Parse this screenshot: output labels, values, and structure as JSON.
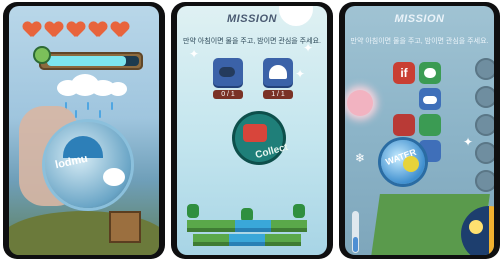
{
  "screens": [
    {
      "hearts_count": 5,
      "water_gauge": {
        "fill_percent": 86
      },
      "orb_label": "lodmu"
    },
    {
      "title": "MISSION",
      "instruction": "만약 아침이면 물을 주고, 밤이면 관심을 주세요.",
      "tasks": [
        {
          "icon": "watering-can-icon",
          "count": "0 / 1"
        },
        {
          "icon": "heart-icon",
          "count": "1 / 1"
        }
      ],
      "collect_label": "Collect"
    },
    {
      "title": "MISSION",
      "instruction": "만약 아침이면 물을 주고, 밤이면 관심을 주세요.",
      "if_label": "if",
      "water_label": "WATER",
      "thermometer_level_percent": 38
    }
  ],
  "colors": {
    "heart": "#e8643c",
    "gauge_fill": "#7de6ef",
    "task_card": "#3b62a8",
    "task_count_bg": "#7a3226",
    "collect_bg": "#1f7f79",
    "if_tile": "#c93f33"
  }
}
